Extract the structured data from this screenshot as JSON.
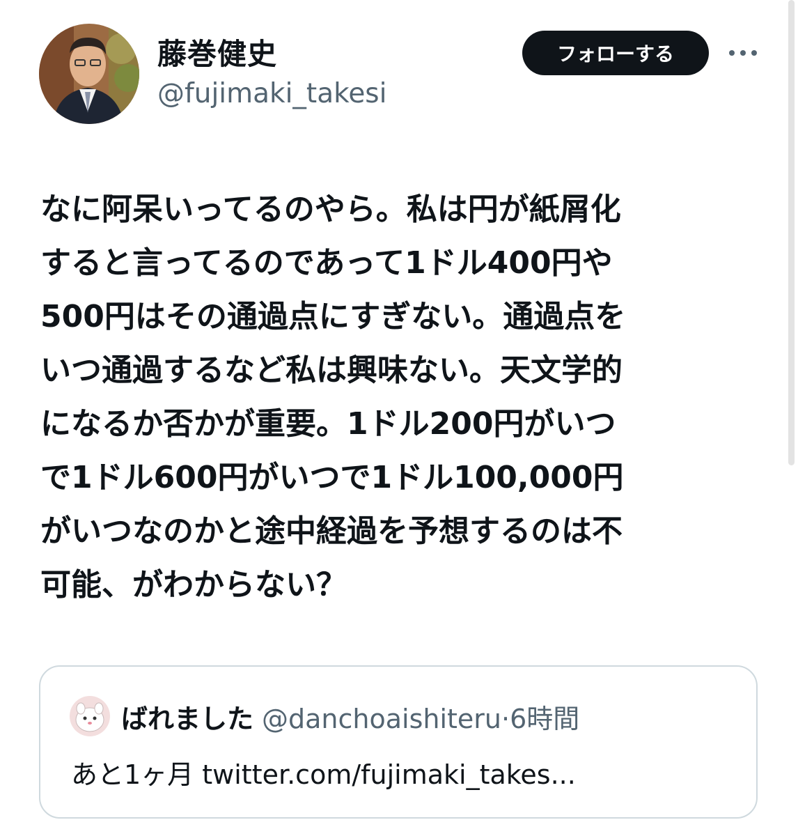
{
  "author": {
    "display_name": "藤巻健史",
    "handle": "@fujimaki_takesi"
  },
  "follow_button": {
    "label": "フォローする"
  },
  "more_icon": "more-horizontal-icon",
  "tweet": {
    "text": "なに阿呆いってるのやら。私は円が紙屑化\nすると言ってるのであって1ドル400円や\n500円はその通過点にすぎない。通過点を\nいつ通過するなど私は興味ない。天文学的\nになるか否かが重要。1ドル200円がいつ\nで1ドル600円がいつで1ドル100,000円\nがいつなのかと途中経過を予想するのは不\n可能、がわからない？"
  },
  "quoted_tweet": {
    "display_name": "ばれました",
    "handle": "@danchoaishiteru",
    "separator": "·",
    "time": "6時間",
    "text": "あと1ヶ月 twitter.com/fujimaki_takes..."
  },
  "colors": {
    "text_primary": "#0f1419",
    "text_secondary": "#536471",
    "border": "#cfd9de",
    "button_bg": "#0f1419"
  }
}
